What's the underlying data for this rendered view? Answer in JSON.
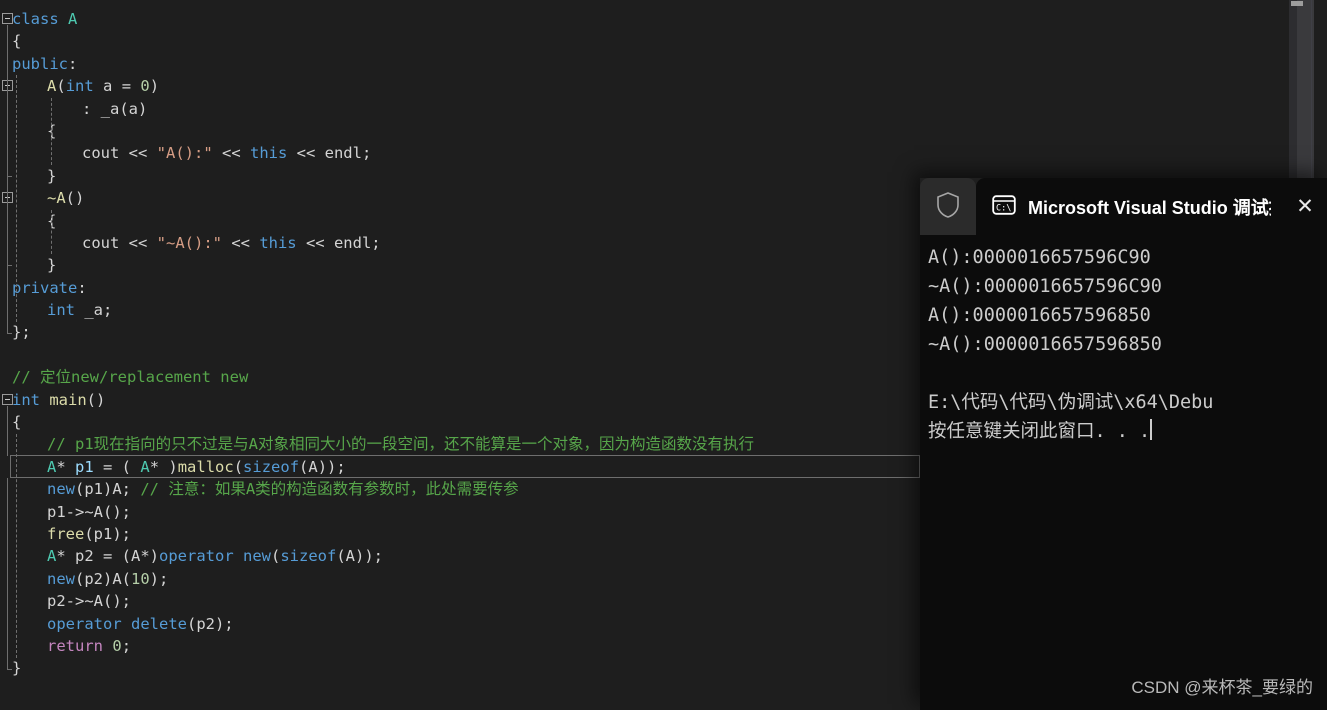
{
  "editor": {
    "lines": [
      {
        "indent": 0,
        "tokens": [
          {
            "t": "class",
            "c": "kw"
          },
          {
            "t": " ",
            "c": "pl"
          },
          {
            "t": "A",
            "c": "type"
          }
        ]
      },
      {
        "indent": 0,
        "tokens": [
          {
            "t": "{",
            "c": "pl"
          }
        ]
      },
      {
        "indent": 0,
        "tokens": [
          {
            "t": "public",
            "c": "kw"
          },
          {
            "t": ":",
            "c": "pl"
          }
        ]
      },
      {
        "indent": 1,
        "tokens": [
          {
            "t": "A",
            "c": "fn"
          },
          {
            "t": "(",
            "c": "pl"
          },
          {
            "t": "int",
            "c": "kw"
          },
          {
            "t": " a ",
            "c": "pl"
          },
          {
            "t": "=",
            "c": "pl"
          },
          {
            "t": " ",
            "c": "pl"
          },
          {
            "t": "0",
            "c": "num"
          },
          {
            "t": ")",
            "c": "pl"
          }
        ]
      },
      {
        "indent": 2,
        "tokens": [
          {
            "t": ": ",
            "c": "pl"
          },
          {
            "t": "_a",
            "c": "pl"
          },
          {
            "t": "(a)",
            "c": "pl"
          }
        ]
      },
      {
        "indent": 1,
        "tokens": [
          {
            "t": "{",
            "c": "pl"
          }
        ]
      },
      {
        "indent": 2,
        "tokens": [
          {
            "t": "cout",
            "c": "pl"
          },
          {
            "t": " << ",
            "c": "pl"
          },
          {
            "t": "\"A():\"",
            "c": "str"
          },
          {
            "t": " << ",
            "c": "pl"
          },
          {
            "t": "this",
            "c": "kw"
          },
          {
            "t": " << ",
            "c": "pl"
          },
          {
            "t": "endl",
            "c": "pl"
          },
          {
            "t": ";",
            "c": "pl"
          }
        ]
      },
      {
        "indent": 1,
        "tokens": [
          {
            "t": "}",
            "c": "pl"
          }
        ]
      },
      {
        "indent": 1,
        "tokens": [
          {
            "t": "~A",
            "c": "fn"
          },
          {
            "t": "()",
            "c": "pl"
          }
        ]
      },
      {
        "indent": 1,
        "tokens": [
          {
            "t": "{",
            "c": "pl"
          }
        ]
      },
      {
        "indent": 2,
        "tokens": [
          {
            "t": "cout",
            "c": "pl"
          },
          {
            "t": " << ",
            "c": "pl"
          },
          {
            "t": "\"~A():\"",
            "c": "str"
          },
          {
            "t": " << ",
            "c": "pl"
          },
          {
            "t": "this",
            "c": "kw"
          },
          {
            "t": " << ",
            "c": "pl"
          },
          {
            "t": "endl",
            "c": "pl"
          },
          {
            "t": ";",
            "c": "pl"
          }
        ]
      },
      {
        "indent": 1,
        "tokens": [
          {
            "t": "}",
            "c": "pl"
          }
        ]
      },
      {
        "indent": 0,
        "tokens": [
          {
            "t": "private",
            "c": "kw"
          },
          {
            "t": ":",
            "c": "pl"
          }
        ]
      },
      {
        "indent": 1,
        "tokens": [
          {
            "t": "int",
            "c": "kw"
          },
          {
            "t": " _a;",
            "c": "pl"
          }
        ]
      },
      {
        "indent": 0,
        "tokens": [
          {
            "t": "};",
            "c": "pl"
          }
        ]
      },
      {
        "indent": 0,
        "tokens": []
      },
      {
        "indent": 0,
        "tokens": [
          {
            "t": "// 定位new/replacement new",
            "c": "cmt"
          }
        ]
      },
      {
        "indent": 0,
        "tokens": [
          {
            "t": "int",
            "c": "kw"
          },
          {
            "t": " ",
            "c": "pl"
          },
          {
            "t": "main",
            "c": "fn"
          },
          {
            "t": "()",
            "c": "pl"
          }
        ]
      },
      {
        "indent": 0,
        "tokens": [
          {
            "t": "{",
            "c": "pl"
          }
        ]
      },
      {
        "indent": 1,
        "tokens": [
          {
            "t": "// p1现在指向的只不过是与A对象相同大小的一段空间，还不能算是一个对象，因为构造函数没有执行",
            "c": "cmt"
          }
        ]
      },
      {
        "indent": 1,
        "current": true,
        "tokens": [
          {
            "t": "A",
            "c": "type"
          },
          {
            "t": "* ",
            "c": "pl"
          },
          {
            "t": "p1",
            "c": "var"
          },
          {
            "t": " = ( ",
            "c": "pl"
          },
          {
            "t": "A",
            "c": "type"
          },
          {
            "t": "* )",
            "c": "pl"
          },
          {
            "t": "malloc",
            "c": "fn"
          },
          {
            "t": "(",
            "c": "pl"
          },
          {
            "t": "sizeof",
            "c": "kw"
          },
          {
            "t": "(A));",
            "c": "pl"
          }
        ]
      },
      {
        "indent": 1,
        "tokens": [
          {
            "t": "new",
            "c": "kw"
          },
          {
            "t": "(p1)A; ",
            "c": "pl"
          },
          {
            "t": "// 注意：如果A类的构造函数有参数时，此处需要传参",
            "c": "cmt"
          }
        ]
      },
      {
        "indent": 1,
        "tokens": [
          {
            "t": "p1->~A();",
            "c": "pl"
          }
        ]
      },
      {
        "indent": 1,
        "tokens": [
          {
            "t": "free",
            "c": "fn"
          },
          {
            "t": "(p1);",
            "c": "pl"
          }
        ]
      },
      {
        "indent": 1,
        "tokens": [
          {
            "t": "A",
            "c": "type"
          },
          {
            "t": "* ",
            "c": "pl"
          },
          {
            "t": "p2",
            "c": "pl"
          },
          {
            "t": " = (A*)",
            "c": "pl"
          },
          {
            "t": "operator new",
            "c": "kw"
          },
          {
            "t": "(",
            "c": "pl"
          },
          {
            "t": "sizeof",
            "c": "kw"
          },
          {
            "t": "(A));",
            "c": "pl"
          }
        ]
      },
      {
        "indent": 1,
        "tokens": [
          {
            "t": "new",
            "c": "kw"
          },
          {
            "t": "(p2)A(",
            "c": "pl"
          },
          {
            "t": "10",
            "c": "num"
          },
          {
            "t": ");",
            "c": "pl"
          }
        ]
      },
      {
        "indent": 1,
        "tokens": [
          {
            "t": "p2->~A();",
            "c": "pl"
          }
        ]
      },
      {
        "indent": 1,
        "tokens": [
          {
            "t": "operator delete",
            "c": "kw"
          },
          {
            "t": "(p2);",
            "c": "pl"
          }
        ]
      },
      {
        "indent": 1,
        "tokens": [
          {
            "t": "return",
            "c": "ctl"
          },
          {
            "t": " ",
            "c": "pl"
          },
          {
            "t": "0",
            "c": "num"
          },
          {
            "t": ";",
            "c": "pl"
          }
        ]
      },
      {
        "indent": 0,
        "tokens": [
          {
            "t": "}",
            "c": "pl"
          }
        ]
      }
    ],
    "colors": {
      "background": "#1e1e1e",
      "keyword": "#569cd6",
      "type": "#4ec9b0",
      "comment": "#57a64a",
      "string": "#d69d85",
      "number": "#b5cea8",
      "function": "#dcdcaa",
      "control": "#c586c0",
      "plain": "#d4d4d4"
    }
  },
  "console": {
    "shield_icon": "shield-icon",
    "app_icon": "command-prompt-icon",
    "title": "Microsoft Visual Studio 调试控",
    "close_label": "✕",
    "output_lines": [
      "A():0000016657596C90",
      "~A():0000016657596C90",
      "A():0000016657596850",
      "~A():0000016657596850",
      "",
      "E:\\代码\\代码\\伪调试\\x64\\Debu",
      "按任意键关闭此窗口. . ."
    ]
  },
  "watermark": {
    "text": "CSDN @来杯茶_要绿的"
  }
}
